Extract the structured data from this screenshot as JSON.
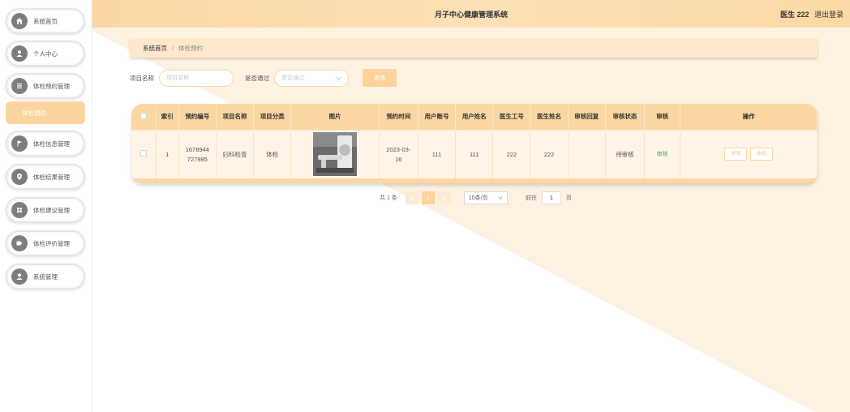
{
  "header": {
    "title": "月子中心健康管理系统",
    "user_name": "医生 222",
    "logout": "退出登录"
  },
  "sidebar": {
    "items": [
      {
        "label": "系统首页",
        "icon": "home-icon"
      },
      {
        "label": "个人中心",
        "icon": "user-icon"
      },
      {
        "label": "体检预约管理",
        "icon": "list-icon"
      },
      {
        "label": "体检信息管理",
        "icon": "flag-icon"
      },
      {
        "label": "体检结果管理",
        "icon": "location-icon"
      },
      {
        "label": "体检建议管理",
        "icon": "grid-icon"
      },
      {
        "label": "体检评价管理",
        "icon": "tag-icon"
      },
      {
        "label": "系统管理",
        "icon": "user-icon"
      }
    ],
    "active_sub": "体检预约"
  },
  "breadcrumb": {
    "home": "系统首页",
    "separator": "/",
    "current": "体检预约"
  },
  "search": {
    "name_label": "项目名称",
    "name_placeholder": "项目名称",
    "pass_label": "是否通过",
    "pass_placeholder": "是否通过",
    "button": "查询"
  },
  "table": {
    "headers": [
      "",
      "索引",
      "预约编号",
      "项目名称",
      "项目分类",
      "图片",
      "预约时间",
      "用户账号",
      "用户姓名",
      "医生工号",
      "医生姓名",
      "审核回复",
      "审核状态",
      "审核",
      "操作"
    ],
    "rows": [
      {
        "index": "1",
        "booking_no_line1": "1678944",
        "booking_no_line2": "727985",
        "project_name": "妇科检查",
        "category": "体检",
        "time_line1": "2023-03-",
        "time_line2": "16",
        "user_account": "111",
        "user_name": "111",
        "doctor_id": "222",
        "doctor_name": "222",
        "reply": "",
        "status": "待审核",
        "review_link": "审核",
        "ops": [
          "详情",
          "体检"
        ]
      }
    ]
  },
  "pagination": {
    "total": "共 1 条",
    "prev": "<",
    "current_page": "1",
    "next": ">",
    "page_size": "10条/页",
    "goto_label": "前往",
    "goto_value": "1",
    "goto_suffix": "页"
  },
  "colors": {
    "accent": "#fcd7a3",
    "accent_strong": "#fdd39a",
    "link_green": "#4caf50"
  }
}
